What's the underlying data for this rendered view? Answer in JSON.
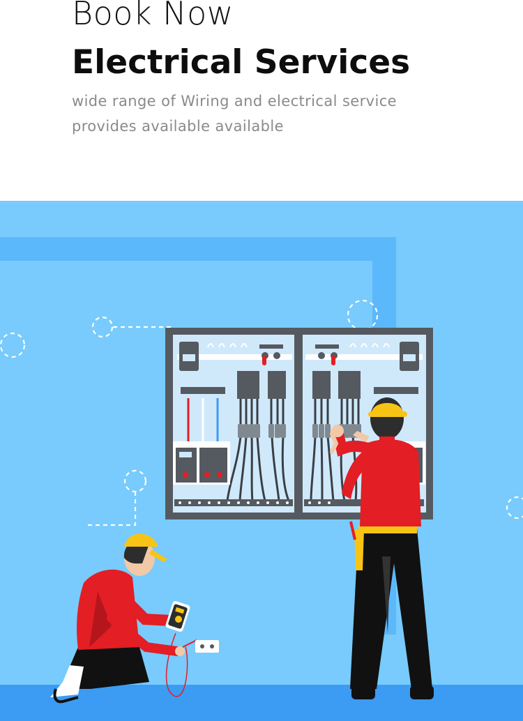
{
  "hero": {
    "kicker": "Book Now",
    "title": "Electrical Services",
    "subtitle_line1": "wide range of Wiring and electrical service",
    "subtitle_line2": "provides available available"
  },
  "colors": {
    "sky": "#78cbfc",
    "frame": "#5bb8fb",
    "floor": "#3c9bf2",
    "panel_border": "#555a60",
    "panel_fill": "#cfe9fb",
    "shirt": "#e31e24",
    "helmet": "#f7c416"
  },
  "icons": [
    "panel-icon",
    "electrician-standing-icon",
    "electrician-kneeling-icon",
    "multimeter-icon",
    "socket-icon"
  ]
}
